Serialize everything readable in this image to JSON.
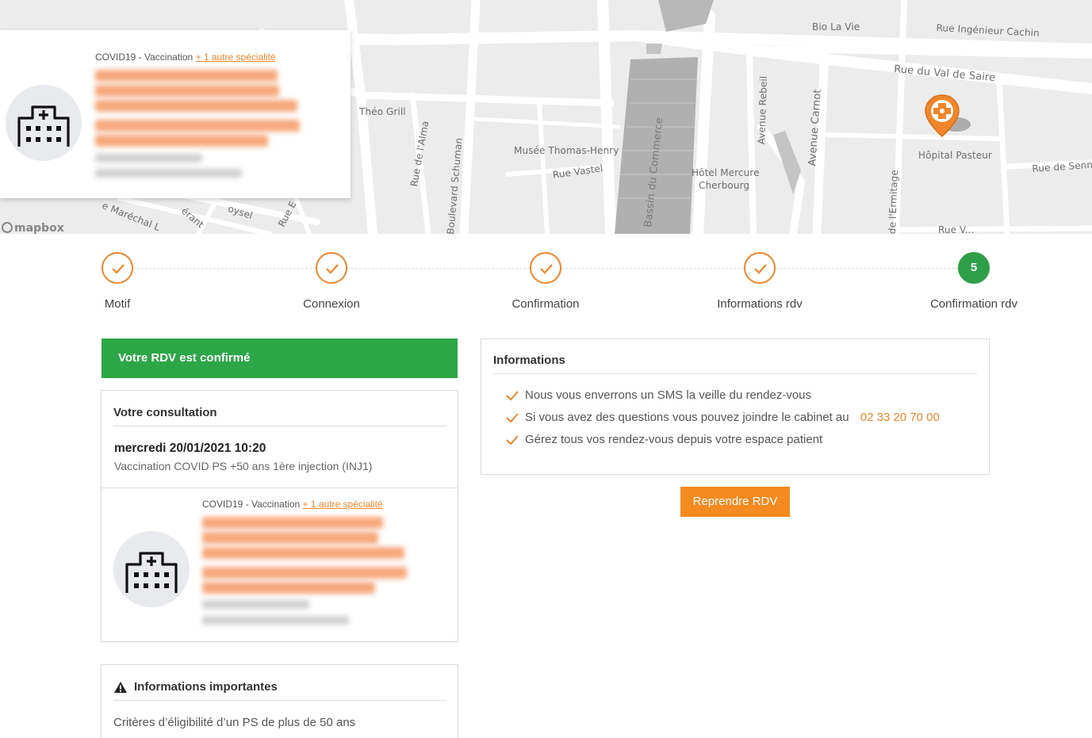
{
  "map": {
    "labels": {
      "bio_la_vie": "Bio La Vie",
      "rue_ingenieur_cachin": "Rue Ingénieur Cachin",
      "rue_val_de_saire": "Rue du Val de Saire",
      "theo_grill": "Théo Grill",
      "rue_alma": "Rue de l'Alma",
      "boulevard_schuman": "Boulevard Schuman",
      "musee": "Musée Thomas-Henry",
      "rue_vastel": "Rue Vastel",
      "bassin_commerce": "Bassin du Commerce",
      "hotel_mercure_1": "Hôtel Mercure",
      "hotel_mercure_2": "Cherbourg",
      "avenue_rebeil": "Avenue Rebeil",
      "avenue_carnot": "Avenue Carnot",
      "hopital_pasteur": "Hôpital Pasteur",
      "rue_senne": "Rue de Senne",
      "ermitage": "de l'Ermitage",
      "rue_vastel_bottom": "Rue V...",
      "marechal": "e Maréchal L",
      "erant": "érant",
      "loysel": "oysel",
      "rue_e": "Rue E"
    },
    "attribution": "mapbox",
    "pin_icon": "hospital-cross-pin-icon",
    "pin_color": "#f08529"
  },
  "map_card": {
    "specialty": "COVID19 - Vaccination",
    "more_specialty": "+ 1 autre spécialité",
    "avatar_icon": "hospital-icon"
  },
  "stepper": {
    "steps": [
      {
        "label": "Motif",
        "state": "done"
      },
      {
        "label": "Connexion",
        "state": "done"
      },
      {
        "label": "Confirmation",
        "state": "done"
      },
      {
        "label": "Informations rdv",
        "state": "done"
      },
      {
        "label": "Confirmation rdv",
        "state": "active",
        "number": "5"
      }
    ],
    "done_color": "#f08529",
    "active_color": "#2e9e48"
  },
  "confirmation": {
    "banner": "Votre RDV est confirmé",
    "banner_color": "#2ca646"
  },
  "consultation": {
    "title": "Votre consultation",
    "datetime": "mercredi 20/01/2021 10:20",
    "motif": "Vaccination COVID PS +50 ans 1ère injection (INJ1)",
    "specialty": "COVID19 - Vaccination",
    "more_specialty": "+ 1 autre spécialité"
  },
  "important": {
    "title": "Informations importantes",
    "icon": "warning-icon",
    "text": "Critères d’éligibilité d’un PS de plus de 50 ans"
  },
  "informations": {
    "title": "Informations",
    "items": [
      "Nous vous enverrons un SMS la veille du rendez-vous",
      "Si vous avez des questions vous pouvez joindre le cabinet au",
      "Gérez tous vos rendez-vous depuis votre espace patient"
    ],
    "phone": "02 33 20 70 00"
  },
  "actions": {
    "reprendre": "Reprendre RDV",
    "accent": "#f48a20"
  }
}
